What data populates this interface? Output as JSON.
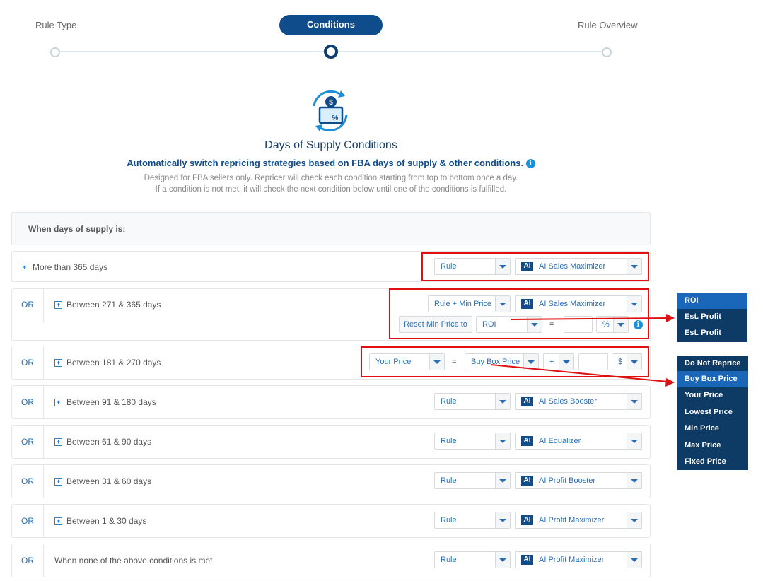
{
  "stepper": {
    "steps": [
      "Rule Type",
      "Conditions",
      "Rule Overview"
    ],
    "active": "Conditions"
  },
  "title": "Days of Supply Conditions",
  "subtitle": "Automatically switch repricing strategies based on FBA days of supply & other conditions.",
  "info_glyph": "i",
  "description": [
    "Designed for FBA sellers only. Repricer will check each condition starting from top to bottom once a day.",
    "If a condition is not met, it will check the next condition below until one of the conditions is fulfilled."
  ],
  "header_label": "When days of supply is:",
  "or_label": "OR",
  "ai_badge": "AI",
  "plus_glyph": "+",
  "rows": [
    {
      "condition": "More than 365 days",
      "type": "Rule",
      "strategy": "AI Sales Maximizer"
    },
    {
      "condition": "Between 271 & 365 days",
      "type": "Rule + Min Price",
      "strategy": "AI Sales Maximizer",
      "reset_button": "Reset Min Price to",
      "reset_metric": "ROI",
      "operator": "=",
      "unit": "%"
    },
    {
      "condition": "Between 181 & 270 days",
      "price": "Your Price",
      "operator": "=",
      "source": "Buy Box Price",
      "sign": "+",
      "unit": "$"
    },
    {
      "condition": "Between 91 & 180 days",
      "type": "Rule",
      "strategy": "AI Sales Booster"
    },
    {
      "condition": "Between 61 & 90 days",
      "type": "Rule",
      "strategy": "AI Equalizer"
    },
    {
      "condition": "Between 31 & 60 days",
      "type": "Rule",
      "strategy": "AI Profit Booster"
    },
    {
      "condition": "Between 1 & 30 days",
      "type": "Rule",
      "strategy": "AI Profit Maximizer"
    },
    {
      "condition": "When none of the above conditions is met",
      "type": "Rule",
      "strategy": "AI Profit Maximizer"
    }
  ],
  "roi_dropdown": {
    "options": [
      "ROI",
      "Est. Profit",
      "Est. Profit Margin"
    ],
    "selected": "ROI"
  },
  "price_dropdown": {
    "options": [
      "Do Not Reprice",
      "Buy Box Price",
      "Your Price",
      "Lowest Price",
      "Min Price",
      "Max Price",
      "Fixed Price"
    ],
    "selected": "Buy Box Price"
  },
  "colors": {
    "primary": "#0e4c8b",
    "highlight": "#e01010",
    "link": "#2a6fb4"
  }
}
